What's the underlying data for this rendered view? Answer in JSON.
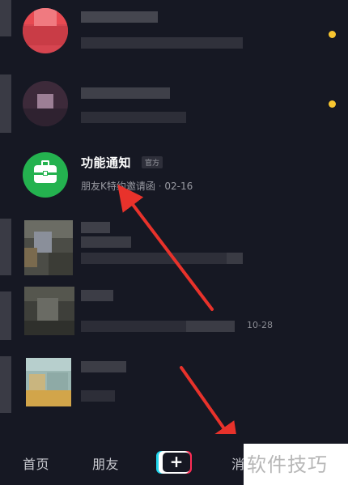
{
  "notification": {
    "title": "功能通知",
    "tag": "官方",
    "subtitle_prefix": "朋友K",
    "subtitle_body": "特约邀请函",
    "separator": "·",
    "date": "02-16",
    "icon": "briefcase-icon"
  },
  "redacted_timestamp": "10-28",
  "tabbar": {
    "home": "首页",
    "friends": "朋友",
    "plus": "+",
    "messages_partial": "消"
  },
  "watermark": "软件技巧",
  "colors": {
    "background": "#161823",
    "unread": "#f8c630",
    "notify_green": "#24b24f",
    "arrow_red": "#e8322b"
  }
}
